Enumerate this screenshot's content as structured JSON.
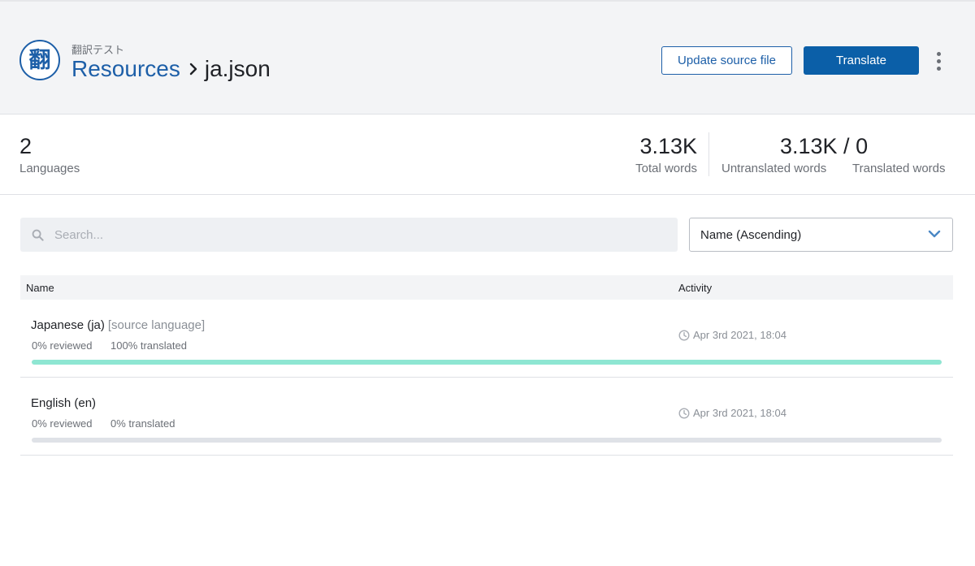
{
  "header": {
    "logo_glyph": "翻",
    "project_name": "翻訳テスト",
    "breadcrumb": {
      "parent": "Resources",
      "current": "ja.json"
    },
    "update_button": "Update source file",
    "translate_button": "Translate"
  },
  "stats": {
    "languages": {
      "value": "2",
      "label": "Languages"
    },
    "total_words": {
      "value": "3.13K",
      "label": "Total words"
    },
    "untranslated_translated": {
      "value": "3.13K / 0",
      "untranslated_label": "Untranslated words",
      "translated_label": "Translated words"
    }
  },
  "search": {
    "placeholder": "Search..."
  },
  "sort": {
    "selected": "Name (Ascending)"
  },
  "table": {
    "columns": {
      "name": "Name",
      "activity": "Activity"
    },
    "rows": [
      {
        "name": "Japanese (ja)",
        "tag": "[source language]",
        "reviewed": "0% reviewed",
        "translated": "100% translated",
        "activity": "Apr 3rd 2021, 18:04",
        "progress": 1.0
      },
      {
        "name": "English (en)",
        "tag": "",
        "reviewed": "0% reviewed",
        "translated": "0% translated",
        "activity": "Apr 3rd 2021, 18:04",
        "progress": 0.0
      }
    ]
  },
  "colors": {
    "accent": "#1d5fa8",
    "primary_button": "#0b5fa8",
    "progress_fill": "#8ee6d2",
    "progress_track": "#dfe2e7"
  },
  "icons": {
    "search": "search-icon",
    "dropdown": "chevron-down-icon",
    "activity": "clock-icon",
    "more": "kebab-menu-icon"
  }
}
